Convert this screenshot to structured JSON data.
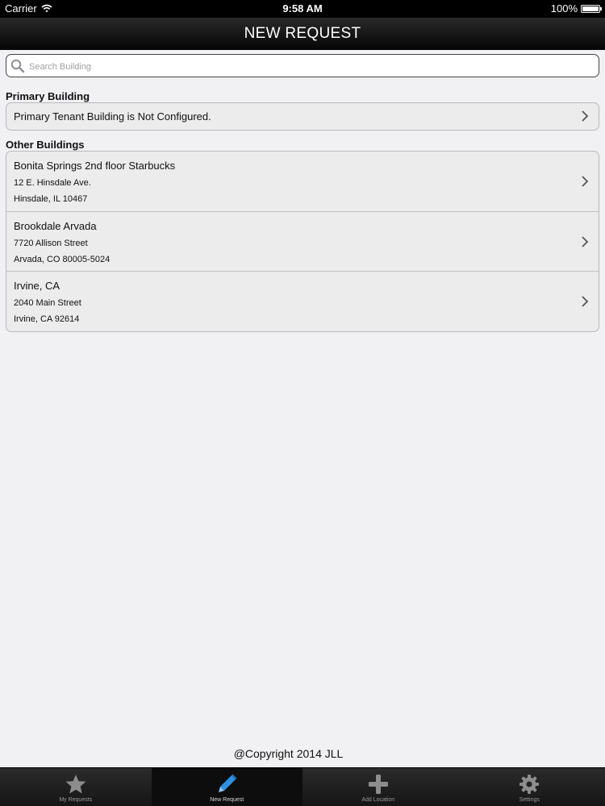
{
  "status_bar": {
    "carrier": "Carrier",
    "time": "9:58 AM",
    "battery": "100%"
  },
  "nav": {
    "title": "NEW REQUEST"
  },
  "search": {
    "placeholder": "Search Building",
    "value": ""
  },
  "primary": {
    "section_title": "Primary Building",
    "message": "Primary Tenant Building is Not Configured."
  },
  "other": {
    "section_title": "Other Buildings",
    "buildings": [
      {
        "name": "Bonita Springs 2nd floor Starbucks",
        "address1": "12 E. Hinsdale Ave.",
        "address2": "Hinsdale, IL 10467"
      },
      {
        "name": "Brookdale Arvada",
        "address1": "7720 Allison Street",
        "address2": "Arvada, CO 80005-5024"
      },
      {
        "name": "Irvine, CA",
        "address1": "2040 Main Street",
        "address2": "Irvine, CA 92614"
      }
    ]
  },
  "footer": {
    "copyright": "@Copyright 2014 JLL"
  },
  "tabs": [
    {
      "label": "My Requests",
      "icon": "star-icon",
      "active": false
    },
    {
      "label": "New Request",
      "icon": "pencil-icon",
      "active": true
    },
    {
      "label": "Add Location",
      "icon": "plus-icon",
      "active": false
    },
    {
      "label": "Settings",
      "icon": "gear-icon",
      "active": false
    }
  ],
  "colors": {
    "background": "#f1f0f2",
    "nav_bar": "#111111",
    "active_tab_icon": "#2f8fe0"
  }
}
